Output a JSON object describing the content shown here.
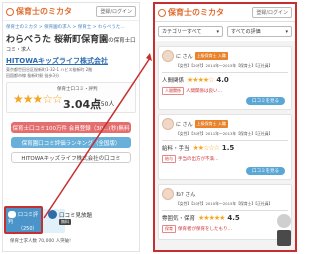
{
  "left": {
    "logo": "保育士のミカタ",
    "login": "登録/ログイン",
    "breadcrumb": "保育士のミカタ > 保育園の求人 > 保育士 > わらべうた…",
    "title": "わらべうた 桜新町保育園",
    "title_suffix": "の保育士口",
    "subtitle": "コミ・求人",
    "corp": "HITOWAキッズライフ株式会社",
    "address1": "東京都世田谷区桜新町1-32-1 ハビス桜新町 2階",
    "address2": "田園都市線 桜新町駅 徒歩3分",
    "rating_label": "保育士口コミ・評判",
    "stars": "★★★☆☆",
    "score": "3.04点",
    "count": "/ 250人",
    "buttons": [
      "保育士口コミ100万件 会員登録（30…(秒)無料",
      "保育園口コミ評価ランキング（全国版）",
      "HITOWAキッズライフ株式会社の口コミ"
    ],
    "highlight_label1": "口コミ評判",
    "highlight_label2": "（250）",
    "kotomi": "口コミ見放題",
    "kotomi_tag": "無料",
    "footer": "保育士求人数 70,000 人突破!"
  },
  "right": {
    "logo": "保育士のミカタ",
    "login": "登録/ログイン",
    "filter1": "カテゴリーすべて",
    "filter2": "すべての評価",
    "reviews": [
      {
        "user": "に さん",
        "tag": "上級保育士 入職",
        "meta": "【女性】【20代】2014年〜2015年【保育士】【正社員】",
        "category": "人間関係",
        "stars": "★★★★☆",
        "score": "4.0",
        "note_tag": "人間関係",
        "note": "人間関係は良い…",
        "more": "口コミを見る"
      },
      {
        "user": "に さん",
        "tag": "上級保育士 入職",
        "meta": "【女性】【30代】2011年〜2013年【保育士】【正社員】",
        "category": "給料・手当",
        "stars": "★★☆☆☆",
        "score": "1.5",
        "note_tag": "給与",
        "note": "手当の出方が不満…",
        "more": "口コミを見る"
      },
      {
        "user": "ね? さん",
        "tag": "",
        "meta": "【女性】【20代】2010年〜2015年【保育士】【正社員】",
        "category": "雰囲気・保育",
        "stars": "★★★★★",
        "score": "4.5",
        "note_tag": "保育",
        "note": "保育者が保育をしたもり…",
        "more": ""
      }
    ]
  },
  "colors": {
    "accent": "#e06a2c",
    "highlight_border": "#c62f2f",
    "button_red": "#e46e6e",
    "button_blue": "#68b0d9",
    "star": "#f5a623"
  }
}
